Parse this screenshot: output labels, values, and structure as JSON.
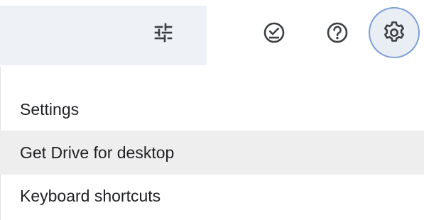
{
  "toolbar": {
    "icons": {
      "filter": "tune-icon",
      "tasks": "ready-for-offline-icon",
      "help": "help-icon",
      "settings": "settings-gear-icon"
    },
    "colors": {
      "search_strip": "#eef2f7",
      "settings_highlight": "#e9edf4",
      "settings_ring": "#7e9fd9",
      "icon": "#3c4043"
    }
  },
  "menu": {
    "items": [
      {
        "label": "Settings"
      },
      {
        "label": "Get Drive for desktop",
        "hovered": true
      },
      {
        "label": "Keyboard shortcuts"
      }
    ],
    "colors": {
      "hover_background": "#eeeeee",
      "text": "#202124"
    }
  }
}
